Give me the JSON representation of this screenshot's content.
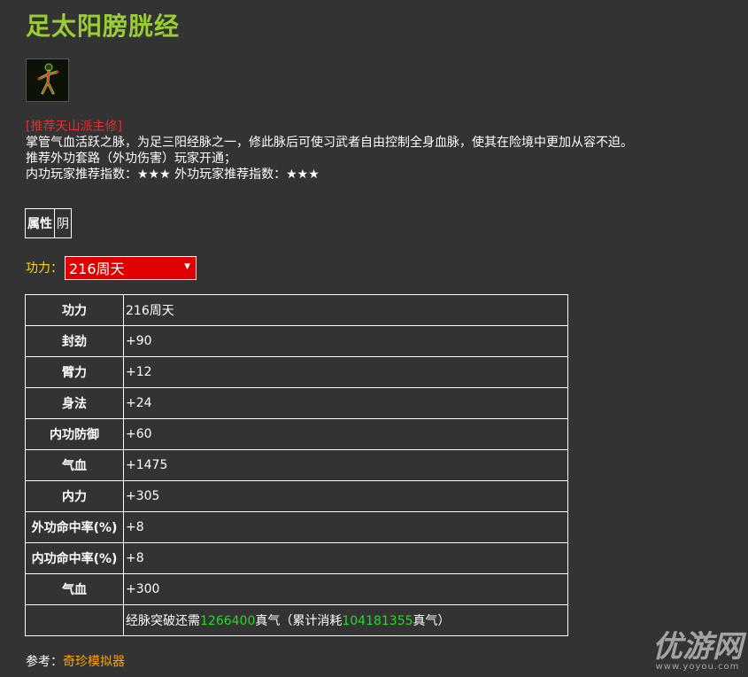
{
  "title": "足太阳膀胱经",
  "avatar_icon": "meridian-body-icon",
  "recommend": "[推荐天山派主修]",
  "description_lines": [
    "掌管气血活跃之脉，为足三阳经脉之一，修此脉后可使习武者自由控制全身血脉，使其在险境中更加从容不迫。",
    "推荐外功套路（外功伤害）玩家开通；",
    "内功玩家推荐指数：★★★ 外功玩家推荐指数：★★★"
  ],
  "attribute": {
    "label": "属性",
    "value": "阴"
  },
  "power": {
    "label": "功力：",
    "selected": "216周天"
  },
  "stats": [
    {
      "key": "功力",
      "value": "216周天"
    },
    {
      "key": "封劲",
      "value": "+90"
    },
    {
      "key": "臂力",
      "value": "+12"
    },
    {
      "key": "身法",
      "value": "+24"
    },
    {
      "key": "内功防御",
      "value": "+60"
    },
    {
      "key": "气血",
      "value": "+1475"
    },
    {
      "key": "内力",
      "value": "+305"
    },
    {
      "key": "外功命中率(%)",
      "value": "+8"
    },
    {
      "key": "内功命中率(%)",
      "value": "+8"
    },
    {
      "key": "气血",
      "value": "+300"
    }
  ],
  "breakthrough": {
    "prefix": "经脉突破还需",
    "needed": "1266400",
    "mid": "真气（累计消耗",
    "total": "104181355",
    "suffix": "真气）"
  },
  "reference": {
    "label": "参考：",
    "link": "奇珍模拟器"
  },
  "watermark": {
    "main": "优游网",
    "sub": "www.yoyou.com"
  },
  "colors": {
    "background": "#333333",
    "title": "#9ACD32",
    "recommend": "#e03030",
    "power_label": "#FFD700",
    "select_bg": "#e00000",
    "highlight": "#22dd22",
    "link": "#FFA500"
  }
}
